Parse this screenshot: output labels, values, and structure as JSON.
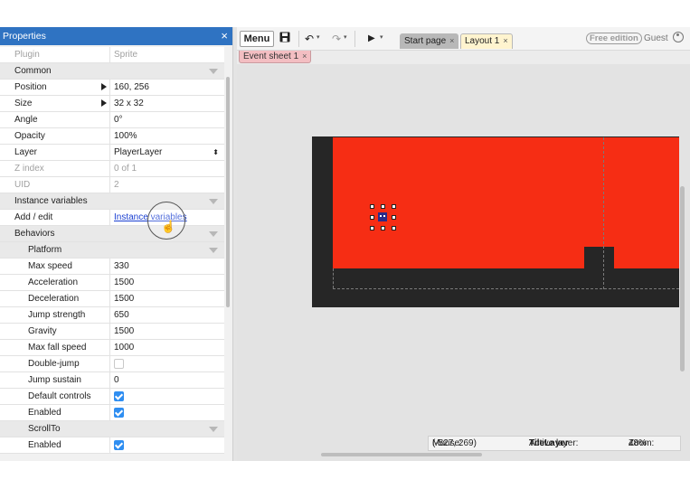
{
  "properties_panel": {
    "title": "Properties",
    "close_glyph": "×",
    "rows": [
      {
        "kind": "prop",
        "label": "Plugin",
        "value": "Sprite",
        "dim": true
      },
      {
        "kind": "section",
        "label": "Common"
      },
      {
        "kind": "prop",
        "label": "Position",
        "value": "160, 256",
        "expand": true
      },
      {
        "kind": "prop",
        "label": "Size",
        "value": "32 x 32",
        "expand": true
      },
      {
        "kind": "prop",
        "label": "Angle",
        "value": "0°"
      },
      {
        "kind": "prop",
        "label": "Opacity",
        "value": "100%"
      },
      {
        "kind": "prop",
        "label": "Layer",
        "value": "PlayerLayer",
        "select": true
      },
      {
        "kind": "prop",
        "label": "Z index",
        "value": "0 of 1",
        "dim": true
      },
      {
        "kind": "prop",
        "label": "UID",
        "value": "2",
        "dim": true
      },
      {
        "kind": "section",
        "label": "Instance variables"
      },
      {
        "kind": "prop",
        "label": "Add / edit",
        "value": "Instance variables",
        "link": true
      },
      {
        "kind": "section",
        "label": "Behaviors"
      },
      {
        "kind": "subsection",
        "label": "Platform"
      },
      {
        "kind": "sub",
        "label": "Max speed",
        "value": "330"
      },
      {
        "kind": "sub",
        "label": "Acceleration",
        "value": "1500"
      },
      {
        "kind": "sub",
        "label": "Deceleration",
        "value": "1500"
      },
      {
        "kind": "sub",
        "label": "Jump strength",
        "value": "650"
      },
      {
        "kind": "sub",
        "label": "Gravity",
        "value": "1500"
      },
      {
        "kind": "sub",
        "label": "Max fall speed",
        "value": "1000"
      },
      {
        "kind": "sub",
        "label": "Double-jump",
        "checkbox": false
      },
      {
        "kind": "sub",
        "label": "Jump sustain",
        "value": "0"
      },
      {
        "kind": "sub",
        "label": "Default controls",
        "checkbox": true
      },
      {
        "kind": "sub",
        "label": "Enabled",
        "checkbox": true
      },
      {
        "kind": "subsection",
        "label": "ScrollTo"
      },
      {
        "kind": "sub",
        "label": "Enabled",
        "checkbox": true
      }
    ]
  },
  "toolbar": {
    "menu_label": "Menu",
    "save_glyph": "💾",
    "undo_glyph": "↶",
    "redo_glyph": "↷",
    "play_glyph": "▶",
    "dropdown_glyph": "▾",
    "tabs": [
      {
        "label": "Start page",
        "close": "×"
      },
      {
        "label": "Layout 1",
        "close": "×"
      }
    ],
    "edition_badge": "Free edition",
    "user_label": "Guest"
  },
  "subtabs": [
    {
      "label": "Event sheet 1",
      "close": "×"
    }
  ],
  "status_bar": {
    "mouse_label": "Mouse:",
    "mouse_value": "(-527, 269)",
    "layer_label": "Active layer:",
    "layer_value": "TileLayer",
    "zoom_label": "Zoom:",
    "zoom_value": "48%"
  },
  "colors": {
    "accent": "#2f73c2",
    "layout_red": "#f62d14",
    "tile_dark": "#262626",
    "checkbox_blue": "#2f8ef1",
    "event_tab": "#f3bec2",
    "layout_tab": "#fff4cf"
  },
  "icons": [
    "close-icon",
    "expand-arrow-icon",
    "collapse-triangle-icon",
    "select-arrows-icon",
    "checkbox-icon",
    "save-icon",
    "undo-icon",
    "redo-icon",
    "play-icon",
    "user-icon",
    "hand-cursor-icon"
  ]
}
